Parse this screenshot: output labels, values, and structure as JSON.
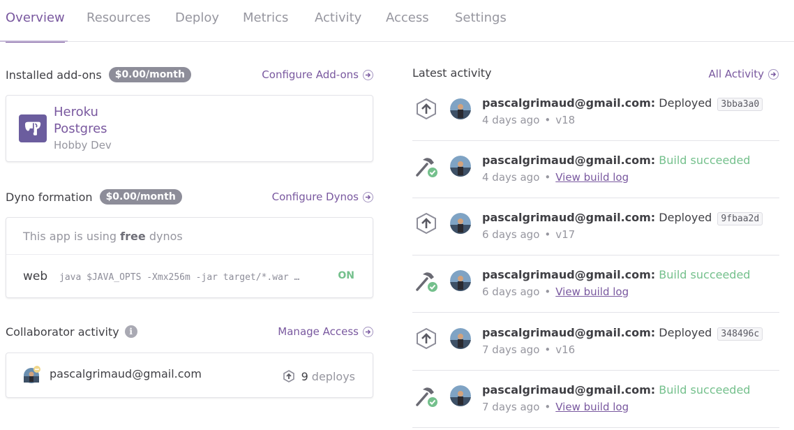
{
  "tabs": [
    {
      "label": "Overview",
      "active": true
    },
    {
      "label": "Resources"
    },
    {
      "label": "Deploy"
    },
    {
      "label": "Metrics"
    },
    {
      "label": "Activity"
    },
    {
      "label": "Access"
    },
    {
      "label": "Settings"
    }
  ],
  "addons": {
    "title": "Installed add-ons",
    "price": "$0.00/month",
    "link": "Configure Add-ons",
    "item": {
      "name": "Heroku Postgres",
      "plan": "Hobby Dev",
      "icon": "postgres-elephant-icon"
    }
  },
  "dynos": {
    "title": "Dyno formation",
    "price": "$0.00/month",
    "link": "Configure Dynos",
    "info_prefix": "This app is using",
    "info_bold": "free",
    "info_suffix": "dynos",
    "process": {
      "type": "web",
      "command": "java $JAVA_OPTS -Xmx256m -jar target/*.war …",
      "status": "ON"
    }
  },
  "collab": {
    "title": "Collaborator activity",
    "link": "Manage Access",
    "email": "pascalgrimaud@gmail.com",
    "count": "9",
    "count_label": "deploys"
  },
  "activity": {
    "title": "Latest activity",
    "all_link": "All Activity",
    "items": [
      {
        "kind": "deploy",
        "user": "pascalgrimaud@gmail.com:",
        "action": "Deployed",
        "sha": "3bba3a0",
        "time": "4 days ago",
        "meta": "v18"
      },
      {
        "kind": "build",
        "user": "pascalgrimaud@gmail.com:",
        "action": "Build succeeded",
        "time": "4 days ago",
        "meta": "View build log"
      },
      {
        "kind": "deploy",
        "user": "pascalgrimaud@gmail.com:",
        "action": "Deployed",
        "sha": "9fbaa2d",
        "time": "6 days ago",
        "meta": "v17"
      },
      {
        "kind": "build",
        "user": "pascalgrimaud@gmail.com:",
        "action": "Build succeeded",
        "time": "6 days ago",
        "meta": "View build log"
      },
      {
        "kind": "deploy",
        "user": "pascalgrimaud@gmail.com:",
        "action": "Deployed",
        "sha": "348496c",
        "time": "7 days ago",
        "meta": "v16"
      },
      {
        "kind": "build",
        "user": "pascalgrimaud@gmail.com:",
        "action": "Build succeeded",
        "time": "7 days ago",
        "meta": "View build log"
      }
    ]
  },
  "colors": {
    "accent": "#79589f",
    "success": "#74c08c",
    "badge": "#8d8d99"
  }
}
